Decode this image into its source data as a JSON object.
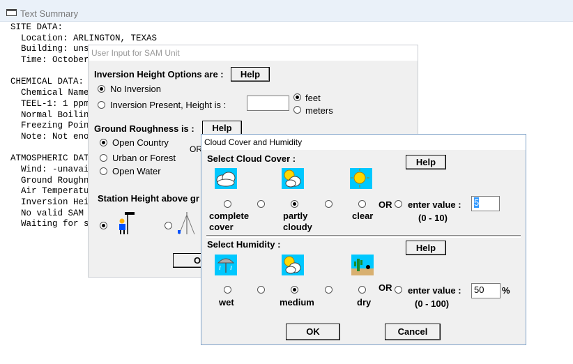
{
  "text_summary": {
    "title": "Text Summary",
    "lines": [
      "SITE DATA:",
      "  Location: ARLINGTON, TEXAS",
      "  Building: uns",
      "  Time: October",
      "",
      "CHEMICAL DATA:",
      "  Chemical Name",
      "  TEEL-1: 1 ppm",
      "  Normal Boilin",
      "  Freezing Poin",
      "  Note: Not eno",
      "",
      "ATMOSPHERIC DAT",
      "  Wind: -unavai",
      "  Ground Roughn",
      "  Air Temperatu",
      "  Inversion Hei",
      "  No valid SAM",
      "  Waiting for s"
    ]
  },
  "sam_dialog": {
    "title": "User Input for SAM Unit",
    "inversion_label": "Inversion Height Options are :",
    "help": "Help",
    "no_inversion": "No Inversion",
    "inversion_present": "Inversion Present,  Height is :",
    "height_value": "",
    "feet": "feet",
    "meters": "meters",
    "ground_label": "Ground Roughness is :",
    "open_country": "Open Country",
    "urban_forest": "Urban or Forest",
    "open_water": "Open Water",
    "or_text": "OR",
    "station_label": "Station Height above gr",
    "ok_partial": "O"
  },
  "cloud_dialog": {
    "title": "Cloud Cover and Humidity",
    "select_cloud": "Select Cloud Cover :",
    "help": "Help",
    "complete_cover": [
      "complete",
      "cover"
    ],
    "partly_cloudy": [
      "partly",
      "cloudy"
    ],
    "clear": "clear",
    "or_text": "OR",
    "enter_value": "enter value :",
    "cloud_value": "5",
    "cloud_range": "(0 - 10)",
    "select_humidity": "Select Humidity :",
    "wet": "wet",
    "medium": "medium",
    "dry": "dry",
    "humidity_value": "50",
    "percent": "%",
    "humidity_range": "(0 - 100)",
    "ok": "OK",
    "cancel": "Cancel"
  },
  "colors": {
    "icon_bg": "#00c8ff",
    "sun": "#ffd800"
  }
}
